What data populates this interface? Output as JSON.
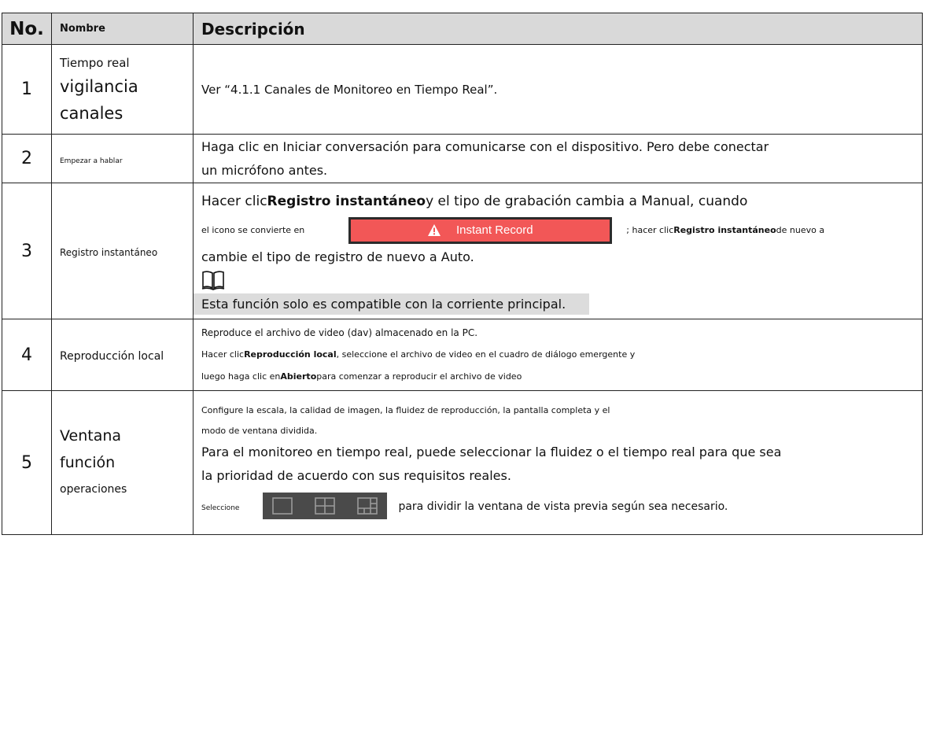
{
  "header": {
    "no": "No.",
    "name": "Nombre",
    "desc": "Descripción"
  },
  "rows": [
    {
      "no": "1",
      "name": [
        "Tiempo real",
        "vigilancia",
        "canales"
      ],
      "desc": "Ver “4.1.1 Canales de Monitoreo en Tiempo Real”."
    },
    {
      "no": "2",
      "name": "Empezar a hablar",
      "desc": [
        "Haga clic en Iniciar conversación para comunicarse con el dispositivo. Pero debe conectar",
        "un micrófono antes."
      ]
    },
    {
      "no": "3",
      "name": "Registro instantáneo",
      "desc_1a": "Hacer clic",
      "desc_1b": "Registro instantáneo",
      "desc_1c": "y el tipo de grabación cambia a Manual, cuando",
      "desc_2a": "el icono se convierte en",
      "button_label": "Instant Record",
      "desc_2b": "; hacer clic",
      "desc_2c": "Registro instantáneo",
      "desc_2d": "de nuevo a",
      "desc_3": "cambie el tipo de registro de nuevo a Auto.",
      "note": "Esta función solo es compatible con la corriente principal."
    },
    {
      "no": "4",
      "name": "Reproducción local",
      "desc_1": "Reproduce el archivo de video (dav) almacenado en la PC.",
      "desc_2a": "Hacer clic",
      "desc_2b": "Reproducción local",
      "desc_2c": ", seleccione el archivo de video en el cuadro de diálogo emergente y",
      "desc_3a": "luego haga clic en",
      "desc_3b": "Abierto",
      "desc_3c": "para comenzar a reproducir el archivo de video"
    },
    {
      "no": "5",
      "name": [
        "Ventana",
        "función",
        "operaciones"
      ],
      "desc_1": "Configure la escala, la calidad de imagen, la fluidez de reproducción, la pantalla completa y el",
      "desc_2": "modo de ventana dividida.",
      "desc_3": "Para el monitoreo en tiempo real, puede seleccionar la fluidez o el tiempo real para que sea",
      "desc_4": "la prioridad de acuerdo con sus requisitos reales.",
      "desc_5a": "Seleccione",
      "desc_5b": "para dividir la ventana de vista previa según sea necesario."
    }
  ],
  "colors": {
    "header_bg": "#d9d9d9",
    "button_bg": "#f25757",
    "note_bg": "#dcdcdc",
    "layout_bar_bg": "#4a4a4a"
  },
  "icons": [
    "warning-icon",
    "book-icon",
    "layout-1-icon",
    "layout-4-icon",
    "layout-6-icon"
  ]
}
